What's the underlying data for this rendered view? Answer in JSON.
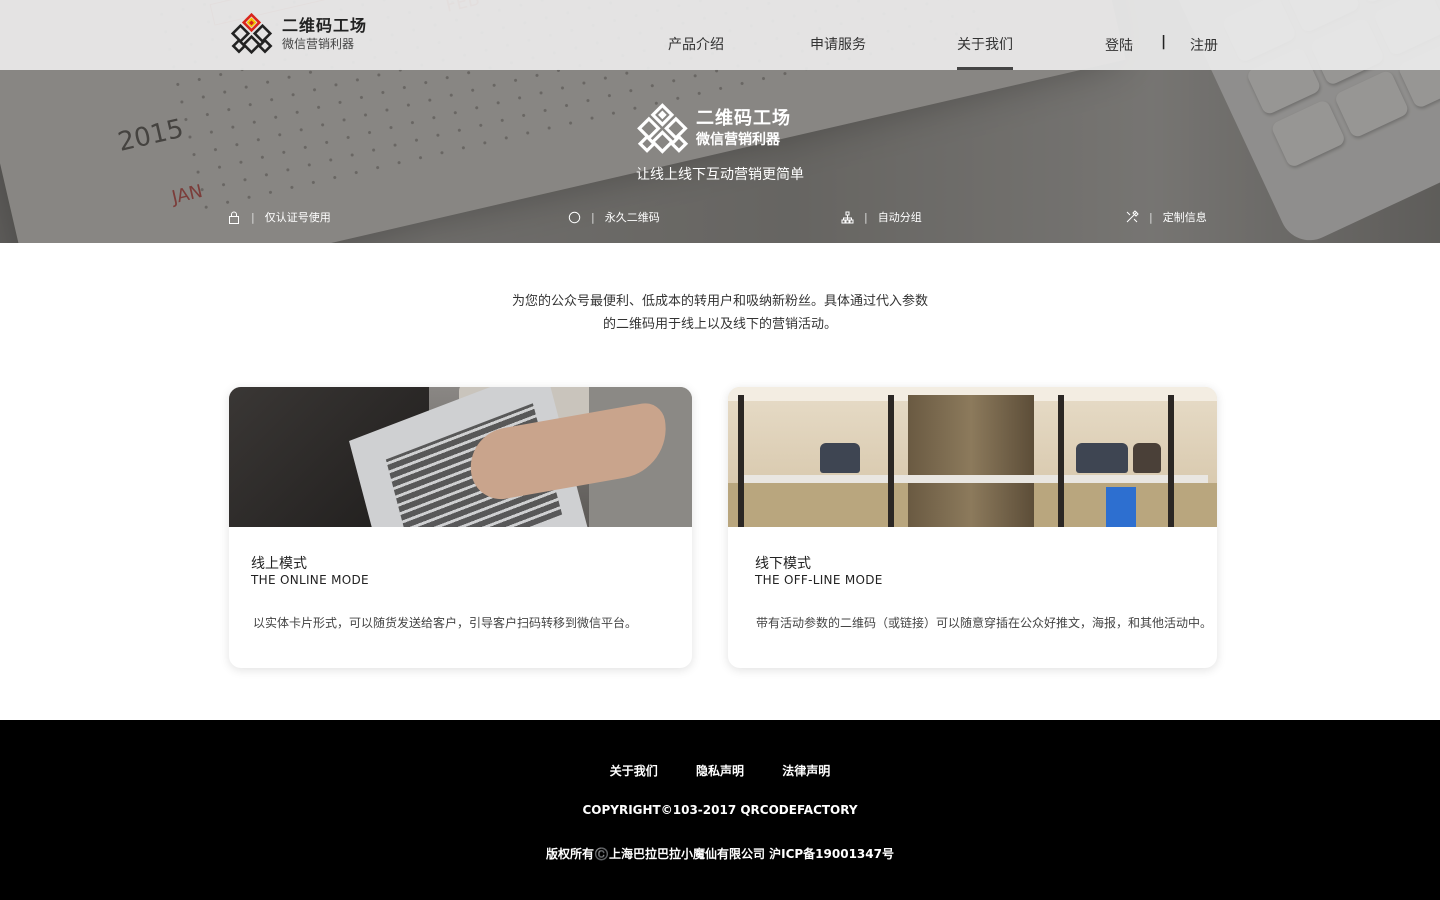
{
  "brand": {
    "name": "二维码工场",
    "tagline": "微信营销利器"
  },
  "nav": {
    "items": [
      "产品介绍",
      "申请服务",
      "关于我们"
    ],
    "active": "关于我们"
  },
  "auth": {
    "login": "登陆",
    "separator": "|",
    "register": "注册"
  },
  "hero": {
    "brand_name": "二维码工场",
    "brand_tagline": "微信营销利器",
    "slogan": "让线上线下互动营销更简单",
    "features": [
      {
        "icon": "lock-icon",
        "label": "仅认证号使用"
      },
      {
        "icon": "circle-icon",
        "label": "永久二维码"
      },
      {
        "icon": "hierarchy-icon",
        "label": "自动分组"
      },
      {
        "icon": "tools-icon",
        "label": "定制信息"
      }
    ],
    "feature_separator": "|"
  },
  "intro": {
    "line1": "为您的公众号最便利、低成本的转用户和吸纳新粉丝。具体通过代入参数",
    "line2": "的二维码用于线上以及线下的营销活动。"
  },
  "cards": [
    {
      "title": "线上模式",
      "subtitle": "THE ONLINE MODE",
      "desc": "以实体卡片形式，可以随货发送给客户，引导客户扫码转移到微信平台。"
    },
    {
      "title": "线下模式",
      "subtitle": "THE OFF-LINE MODE",
      "desc": "带有活动参数的二维码（或链接）可以随意穿插在公众好推文，海报，和其他活动中。"
    }
  ],
  "footer": {
    "links": [
      "关于我们",
      "隐私声明",
      "法律声明"
    ],
    "copyright": "COPYRIGHT©103-2017 QRCODEFACTORY",
    "icp": "版权所有©️上海巴拉巴拉小魔仙有限公司 沪ICP备19001347号"
  },
  "colors": {
    "accent_red": "#d9261c",
    "footer_bg": "#000000",
    "nav_text": "#333333"
  }
}
